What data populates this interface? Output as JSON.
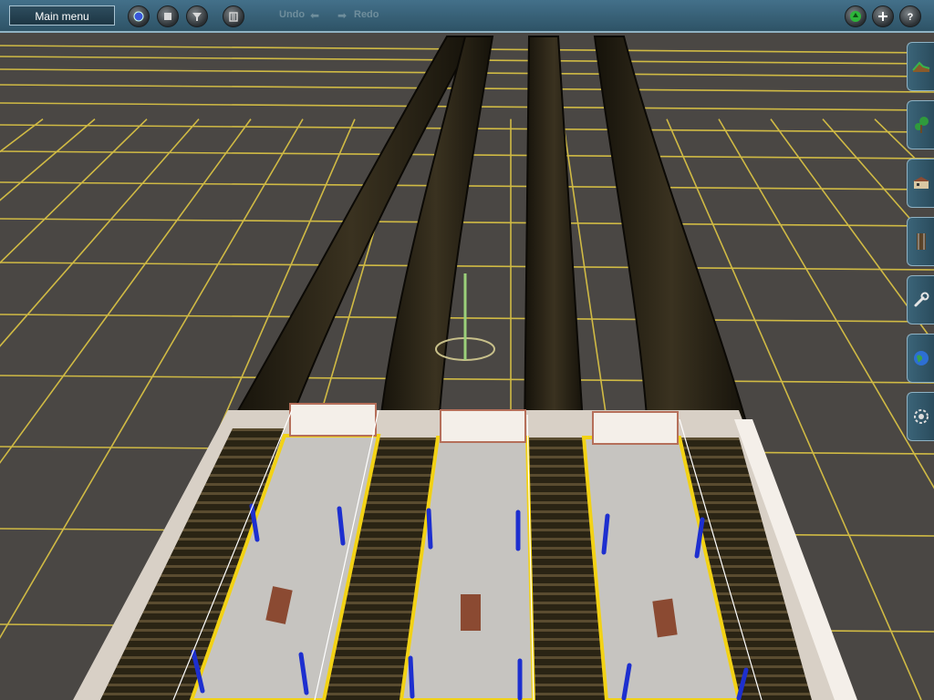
{
  "toolbar": {
    "main_menu_label": "Main menu",
    "undo_label": "Undo",
    "redo_label": "Redo",
    "left_tools": [
      "object-icon",
      "stop-icon",
      "filter-icon",
      "delete-icon"
    ],
    "right_tools": [
      "go-icon",
      "add-icon",
      "help-icon"
    ]
  },
  "side_palette": {
    "tools": [
      "terrain-icon",
      "tree-icon",
      "building-icon",
      "track-icon",
      "wrench-icon",
      "globe-icon",
      "settings-icon"
    ]
  },
  "scene": {
    "grid_color": "#e8cf45",
    "ground_color": "#4a4744",
    "platform_color": "#c6c4c0",
    "edge_color": "#f2d215",
    "marker_color": "#1d2fcf"
  }
}
